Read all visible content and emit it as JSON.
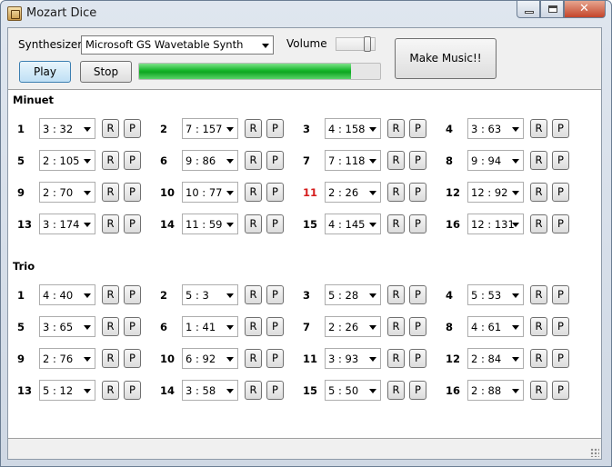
{
  "window": {
    "title": "Mozart Dice",
    "minimize_glyph": "",
    "maximize_glyph": "",
    "close_glyph": "✕"
  },
  "toolbar": {
    "synth_label": "Synthesizer",
    "synth_value": "Microsoft GS Wavetable Synth",
    "volume_label": "Volume",
    "volume_level": 0.85,
    "play_label": "Play",
    "stop_label": "Stop",
    "make_music_label": "Make Music!!",
    "progress_fraction": 0.88
  },
  "buttons": {
    "r": "R",
    "p": "P"
  },
  "minuet": {
    "title": "Minuet",
    "measures": [
      {
        "n": "1",
        "value": "3 : 32"
      },
      {
        "n": "2",
        "value": "7 : 157"
      },
      {
        "n": "3",
        "value": "4 : 158"
      },
      {
        "n": "4",
        "value": "3 : 63"
      },
      {
        "n": "5",
        "value": "2 : 105"
      },
      {
        "n": "6",
        "value": "9 : 86"
      },
      {
        "n": "7",
        "value": "7 : 118"
      },
      {
        "n": "8",
        "value": "9 : 94"
      },
      {
        "n": "9",
        "value": "2 : 70"
      },
      {
        "n": "10",
        "value": "10 : 77"
      },
      {
        "n": "11",
        "value": "2 : 26",
        "highlight": true
      },
      {
        "n": "12",
        "value": "12 : 92"
      },
      {
        "n": "13",
        "value": "3 : 174"
      },
      {
        "n": "14",
        "value": "11 : 59"
      },
      {
        "n": "15",
        "value": "4 : 145"
      },
      {
        "n": "16",
        "value": "12 : 131"
      }
    ]
  },
  "trio": {
    "title": "Trio",
    "measures": [
      {
        "n": "1",
        "value": "4 : 40"
      },
      {
        "n": "2",
        "value": "5 : 3"
      },
      {
        "n": "3",
        "value": "5 : 28"
      },
      {
        "n": "4",
        "value": "5 : 53"
      },
      {
        "n": "5",
        "value": "3 : 65"
      },
      {
        "n": "6",
        "value": "1 : 41"
      },
      {
        "n": "7",
        "value": "2 : 26"
      },
      {
        "n": "8",
        "value": "4 : 61"
      },
      {
        "n": "9",
        "value": "2 : 76"
      },
      {
        "n": "10",
        "value": "6 : 92"
      },
      {
        "n": "11",
        "value": "3 : 93"
      },
      {
        "n": "12",
        "value": "2 : 84"
      },
      {
        "n": "13",
        "value": "5 : 12"
      },
      {
        "n": "14",
        "value": "3 : 58"
      },
      {
        "n": "15",
        "value": "5 : 50"
      },
      {
        "n": "16",
        "value": "2 : 88"
      }
    ]
  },
  "colors": {
    "highlight": "#d51c1c",
    "progress": "#15b52a"
  }
}
